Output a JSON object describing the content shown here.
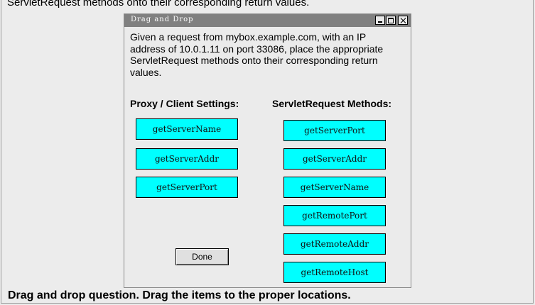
{
  "page": {
    "top_text": "ServletRequest methods onto their corresponding return values.",
    "instruction": "Drag and drop question. Drag the items to the proper locations."
  },
  "dialog": {
    "title": "Drag and Drop",
    "question": "Given a request from mybox.example.com, with an IP address of 10.0.1.11 on port 33086, place the appropriate ServletRequest methods onto their corresponding return values.",
    "left_heading": "Proxy / Client Settings:",
    "right_heading": "ServletRequest Methods:",
    "drop_targets": [
      "getServerName",
      "getServerAddr",
      "getServerPort"
    ],
    "methods": [
      "getServerPort",
      "getServerAddr",
      "getServerName",
      "getRemotePort",
      "getRemoteAddr",
      "getRemoteHost"
    ],
    "done_label": "Done"
  },
  "colors": {
    "item_fill": "#00ffff",
    "titlebar": "#808080",
    "panel": "#ebebeb"
  }
}
